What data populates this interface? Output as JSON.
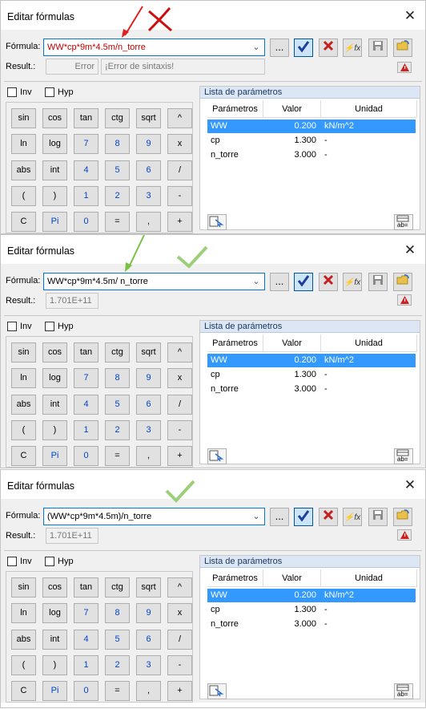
{
  "dialogs": [
    {
      "title": "Editar fórmulas",
      "formula_label": "Fórmula:",
      "formula": "WW*cp*9m*4.5m/n_torre",
      "formula_color": "#c00000",
      "result_label": "Result.:",
      "result_value": "Error",
      "result_error": "¡Error de sintaxis!",
      "inv": "Inv",
      "hyp": "Hyp",
      "panel_title": "Lista de parámetros",
      "headers": [
        "Parámetros",
        "Valor",
        "Unidad"
      ],
      "params": [
        {
          "name": "WW",
          "value": "0.200",
          "unit": "kN/m^2"
        },
        {
          "name": "cp",
          "value": "1.300",
          "unit": "-"
        },
        {
          "name": "n_torre",
          "value": "3.000",
          "unit": "-"
        }
      ]
    },
    {
      "title": "Editar fórmulas",
      "formula_label": "Fórmula:",
      "formula": "WW*cp*9m*4.5m/ n_torre",
      "formula_color": "#000000",
      "result_label": "Result.:",
      "result_value": "1.701E+11",
      "result_error": "",
      "inv": "Inv",
      "hyp": "Hyp",
      "panel_title": "Lista de parámetros",
      "headers": [
        "Parámetros",
        "Valor",
        "Unidad"
      ],
      "params": [
        {
          "name": "WW",
          "value": "0.200",
          "unit": "kN/m^2"
        },
        {
          "name": "cp",
          "value": "1.300",
          "unit": "-"
        },
        {
          "name": "n_torre",
          "value": "3.000",
          "unit": "-"
        }
      ]
    },
    {
      "title": "Editar fórmulas",
      "formula_label": "Fórmula:",
      "formula": "(WW*cp*9m*4.5m)/n_torre",
      "formula_color": "#000000",
      "result_label": "Result.:",
      "result_value": "1.701E+11",
      "result_error": "",
      "inv": "Inv",
      "hyp": "Hyp",
      "panel_title": "Lista de parámetros",
      "headers": [
        "Parámetros",
        "Valor",
        "Unidad"
      ],
      "params": [
        {
          "name": "WW",
          "value": "0.200",
          "unit": "kN/m^2"
        },
        {
          "name": "cp",
          "value": "1.300",
          "unit": "-"
        },
        {
          "name": "n_torre",
          "value": "3.000",
          "unit": "-"
        }
      ]
    }
  ],
  "keypad": [
    [
      "sin",
      "cos",
      "tan",
      "ctg",
      "sqrt",
      "^"
    ],
    [
      "ln",
      "log",
      "7",
      "8",
      "9",
      "x"
    ],
    [
      "abs",
      "int",
      "4",
      "5",
      "6",
      "/"
    ],
    [
      "(",
      ")",
      "1",
      "2",
      "3",
      "-"
    ],
    [
      "C",
      "Pi",
      "0",
      "=",
      ",",
      "+"
    ]
  ],
  "toolbar": {
    "more_label": "...",
    "fx_label": "fx"
  },
  "colors": {
    "accent": "#0078d7",
    "selected_row": "#3399ff",
    "error_mark": "#e02020",
    "ok_mark": "#7ac043"
  }
}
